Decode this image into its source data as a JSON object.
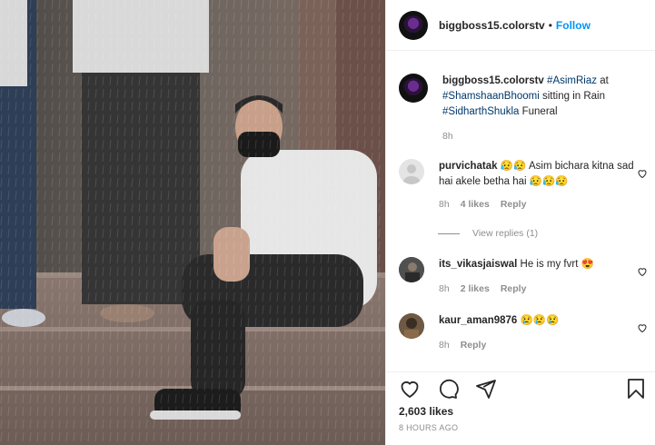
{
  "header": {
    "username": "biggboss15.colorstv",
    "separator": "•",
    "follow_label": "Follow"
  },
  "caption": {
    "username": "biggboss15.colorstv",
    "hashtag1": "#AsimRiaz",
    "text1": " at ",
    "hashtag2": "#ShamshaanBhoomi",
    "text2": " sitting in Rain ",
    "hashtag3": "#SidharthShukla",
    "text3": " Funeral",
    "time": "8h"
  },
  "comments": [
    {
      "username": "purvichatak",
      "text": "Asim bichara kitna sad hai akele betha hai",
      "emoji_prefix": "😥😥",
      "emoji_suffix": "😥😥😥",
      "time": "8h",
      "likes": "4 likes",
      "reply_label": "Reply",
      "view_replies": "View replies (1)"
    },
    {
      "username": "its_vikasjaiswal",
      "text": "He is my fvrt",
      "emoji_suffix": "😍",
      "time": "8h",
      "likes": "2 likes",
      "reply_label": "Reply"
    },
    {
      "username": "kaur_aman9876",
      "text": "",
      "emoji_suffix": "😢😢😢",
      "time": "8h",
      "reply_label": "Reply"
    }
  ],
  "footer": {
    "likes": "2,603 likes",
    "posted": "8 HOURS AGO"
  },
  "icons": {
    "like": "heart-icon",
    "comment": "comment-icon",
    "share": "share-icon",
    "save": "bookmark-icon"
  },
  "colors": {
    "accent": "#0095f6",
    "hashtag": "#00376b",
    "muted": "#8e8e8e"
  }
}
